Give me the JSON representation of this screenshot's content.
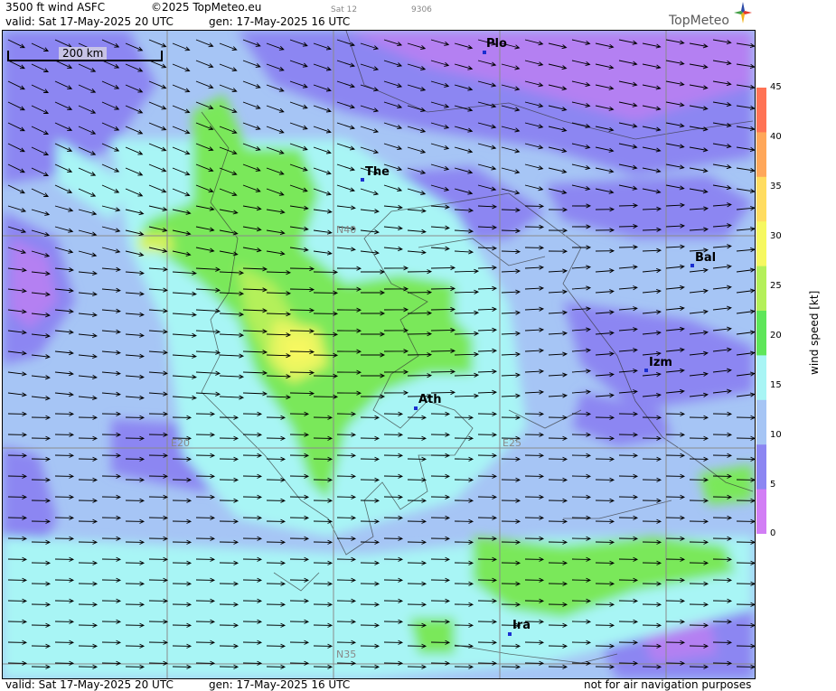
{
  "header": {
    "product": "3500 ft wind ASFC",
    "copyright": "©2025 TopMeteo.eu",
    "run_label": "Sat 12",
    "code": "9306",
    "valid": "valid:  Sat  17-May-2025  20 UTC",
    "generated": "gen: 17-May-2025 16 UTC"
  },
  "logo": {
    "text": "TopMeteo",
    "icon": "compass-star-icon"
  },
  "scale": {
    "label": "200 km"
  },
  "cities": [
    {
      "code": "Plo"
    },
    {
      "code": "The"
    },
    {
      "code": "Bal"
    },
    {
      "code": "Izm"
    },
    {
      "code": "Ath"
    },
    {
      "code": "Ira"
    }
  ],
  "grid_labels": [
    "N40",
    "E20",
    "E25",
    "N35"
  ],
  "legend": {
    "title": "wind speed [kt]",
    "ticks": [
      "45",
      "40",
      "35",
      "30",
      "25",
      "20",
      "15",
      "10",
      "5",
      "0"
    ],
    "colors": [
      "#ff7355",
      "#ffa75a",
      "#ffdc60",
      "#f6f860",
      "#b4f05a",
      "#5ee65a",
      "#a8f5f5",
      "#a6c5f5",
      "#8c86f2",
      "#d27ef5"
    ]
  },
  "footer": {
    "valid": "valid:  Sat  17-May-2025  20 UTC",
    "generated": "gen: 17-May-2025 16 UTC",
    "disclaimer": "not for air navigation purposes"
  },
  "colors": {
    "calm_purple": "#b480f2",
    "light_wind_violet": "#8c86f2",
    "moderate_blue": "#a6c5f5",
    "cyan": "#a8f5f5",
    "green": "#7ae85a",
    "yellow": "#f6f860",
    "city_marker": "#1a2fd0"
  }
}
